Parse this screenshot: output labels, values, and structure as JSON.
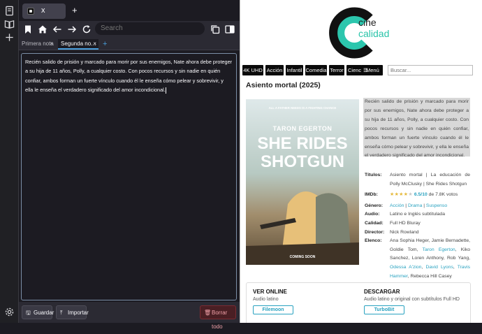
{
  "browser": {
    "tab": {
      "title": "x",
      "favicon": "cine-calidad-favicon"
    },
    "new_tab": "+",
    "url_placeholder": "Search"
  },
  "notes": {
    "tabs": [
      {
        "label": "Primera nota",
        "close": "×",
        "active": false
      },
      {
        "label": "Segunda no…",
        "close": "×",
        "active": true
      }
    ],
    "add_tab": "+",
    "content": "Recién salido de prisión y marcado para morir por sus enemigos, Nate ahora debe proteger a su hija de 11 años, Polly, a cualquier costo. Con pocos recursos y sin nadie en quién confiar, ambos forman un fuerte vínculo cuando él le enseña cómo pelear y sobrevivir, y ella le enseña el verdadero significado del amor incondicional.",
    "buttons": {
      "save": "Guardar",
      "import": "Importar",
      "delete": "Borrar todo"
    }
  },
  "site": {
    "logo": {
      "line1": "cine",
      "line2": "calidad"
    },
    "menu": [
      "4K UHD",
      "Acción",
      "Infantil",
      "Comedia",
      "Terror",
      "Cienc",
      "Menú"
    ],
    "search_placeholder": "Buscar...",
    "movie_title": "Asiento mortal (2025)",
    "poster": {
      "tagline": "ALL A FATHER NEEDS IS A FIGHTING CHANCE",
      "actor": "TARON EGERTON",
      "title_1": "SHE RIDES",
      "title_2": "SHOTGUN",
      "footer": "COMING SOON"
    },
    "synopsis": "Recién salido de prisión y marcado para morir por sus enemigos, Nate ahora debe proteger a su hija de 11 años, Polly, a cualquier costo. Con pocos recursos y sin nadie en quién confiar, ambos forman un fuerte vínculo cuando él le enseña cómo pelear y sobrevivir, y ella le enseña el verdadero significado del amor incondicional.",
    "info": {
      "titles_label": "Títulos:",
      "titles": "Asiento mortal | La educación de Polly McClusky | She Rides Shotgun",
      "imdb_label": "IMDb:",
      "rating": "6.5/10",
      "rating_stars": 3.5,
      "votes": "de 7.8K votos",
      "genre_label": "Género:",
      "genres": [
        "Acción",
        "Drama",
        "Suspenso"
      ],
      "audio_label": "Audio:",
      "audio": "Latino e Inglés subtitulada",
      "quality_label": "Calidad:",
      "quality": "Full HD Bluray",
      "director_label": "Director:",
      "director": "Nick Rowland",
      "cast_label": "Elenco:",
      "cast_plain_1": "Ana Sophia Heger, Jamie Bernadette, Goldie Tom,",
      "cast_link_1": "Taron Egerton",
      "cast_plain_2": ", Kiko Sanchez, Loren Anthony, Rob Yang,",
      "cast_link_2": "Odessa A'zion",
      "cast_link_3": "David Lyons",
      "cast_link_4": "Travis Hammer",
      "cast_plain_3": ", Rebecca Hill Casey"
    },
    "watch": {
      "heading": "VER ONLINE",
      "sub": "Audio latino",
      "button": "Filemoon"
    },
    "download": {
      "heading": "DESCARGAR",
      "sub": "Audio latino y original con subtítulos Full HD",
      "button": "TurboBit"
    }
  }
}
